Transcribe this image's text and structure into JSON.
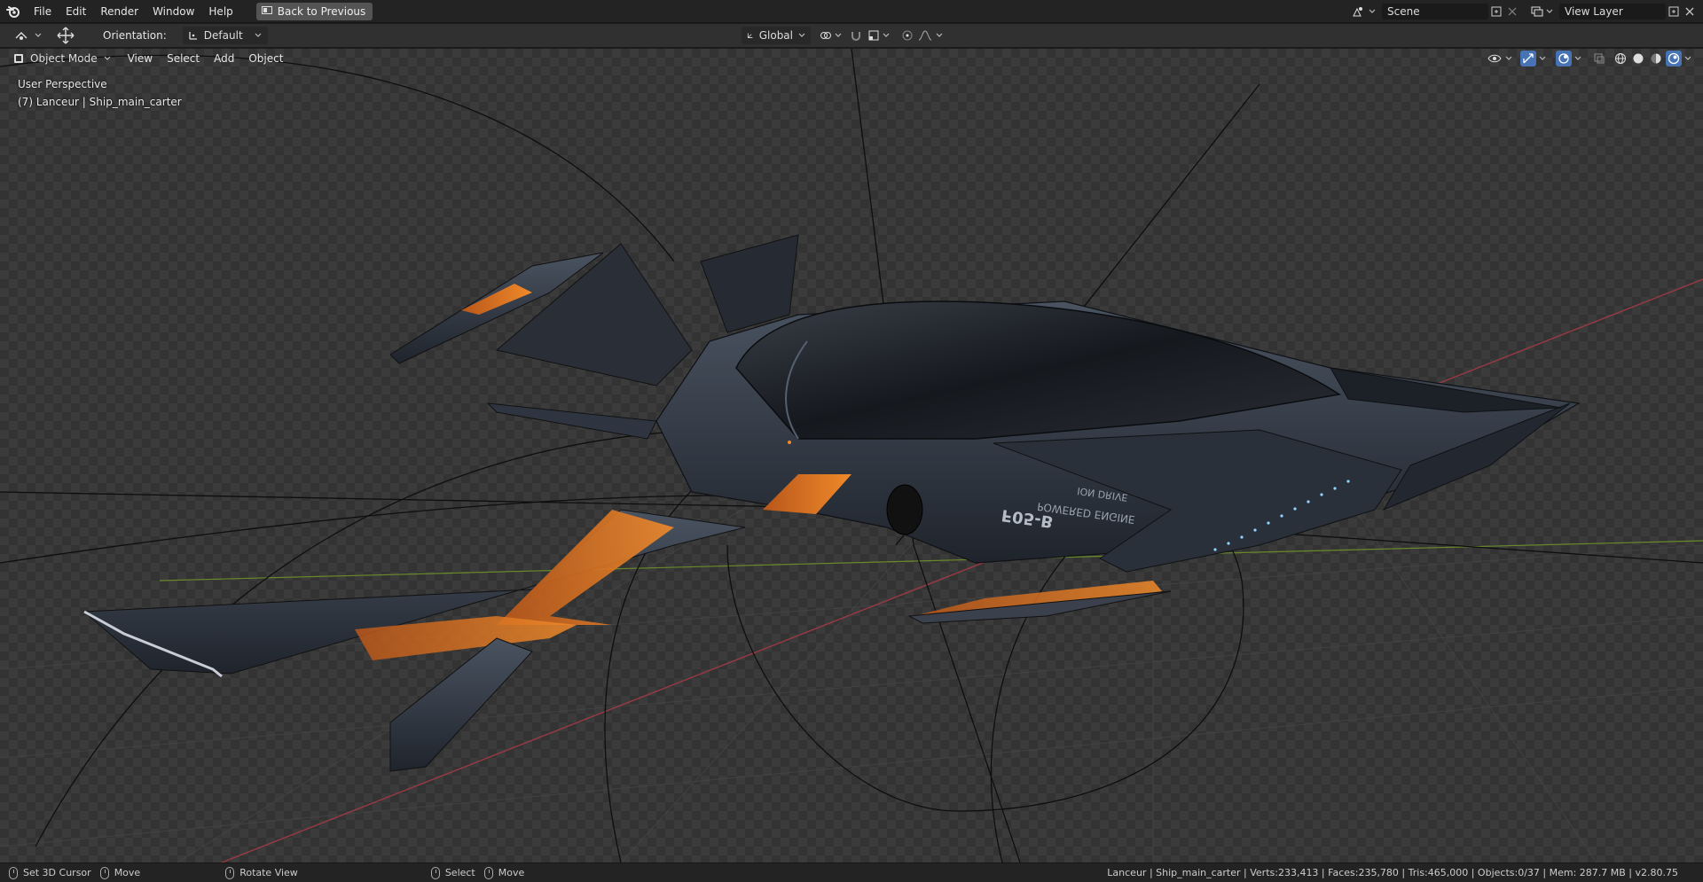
{
  "topbar": {
    "menus": [
      "File",
      "Edit",
      "Render",
      "Window",
      "Help"
    ],
    "back_button": "Back to Previous",
    "scene_field": "Scene",
    "view_layer_field": "View Layer"
  },
  "toolheader": {
    "orientation_label": "Orientation:",
    "orientation_value": "Default",
    "transform_orientation": "Global"
  },
  "viewport_header": {
    "mode": "Object Mode",
    "menus": [
      "View",
      "Select",
      "Add",
      "Object"
    ]
  },
  "viewport": {
    "perspective_label": "User Perspective",
    "object_label": "(7) Lanceur | Ship_main_carter",
    "hull_text_1": "ION DRIVE",
    "hull_text_2": "POWERED ENGINE",
    "hull_text_3": "F05-B"
  },
  "statusbar": {
    "items": [
      "Set 3D Cursor",
      "Move",
      "Rotate View",
      "Select",
      "Move"
    ],
    "stats": "Lanceur | Ship_main_carter | Verts:233,413 | Faces:235,780 | Tris:465,000 | Objects:0/37 | Mem: 287.7 MB | v2.80.75"
  },
  "colors": {
    "accent_blue": "#4772b3",
    "hull_orange": "#e07a1f",
    "hull_dark": "#2c323c"
  }
}
